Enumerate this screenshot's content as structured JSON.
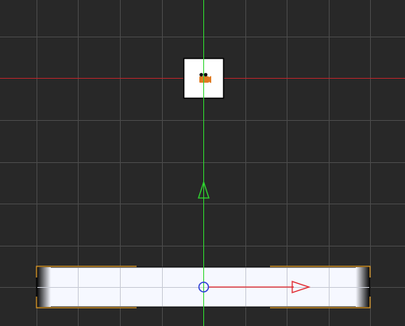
{
  "viewport": {
    "background": "#282828",
    "grid_color": "#4a4a4a",
    "x_axis_color": "#b3262b",
    "y_axis_color": "#2fd62f"
  },
  "entities": {
    "camera": {
      "icon": "camera-icon",
      "box_color": "#ffffff",
      "body_color": "#e07b22",
      "lens_color": "#111111"
    },
    "platform": {
      "fill": "#f6f8ff",
      "edge_color": "#000000",
      "selection_color": "#e6a12a"
    }
  },
  "gizmo": {
    "icon": "move-gizmo-icon",
    "x_handle_color": "#e0242b",
    "y_handle_color": "#2fd62f",
    "center_color": "#2a3bd6"
  }
}
